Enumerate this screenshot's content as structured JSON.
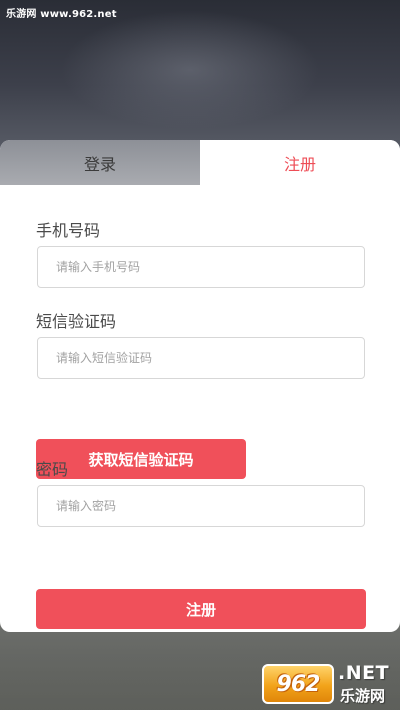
{
  "watermark_top": "乐游网 www.962.net",
  "tabs": {
    "login": "登录",
    "register": "注册"
  },
  "form": {
    "phone_label": "手机号码",
    "phone_placeholder": "请输入手机号码",
    "sms_label": "短信验证码",
    "sms_placeholder": "请输入短信验证码",
    "get_sms_button": "获取短信验证码",
    "password_label": "密码",
    "password_placeholder": "请输入密码",
    "register_button": "注册"
  },
  "logo": {
    "number": "962",
    "suffix": ".NET",
    "name": "乐游网"
  },
  "colors": {
    "accent": "#f0505a",
    "active_tab_text": "#ee4d56"
  }
}
